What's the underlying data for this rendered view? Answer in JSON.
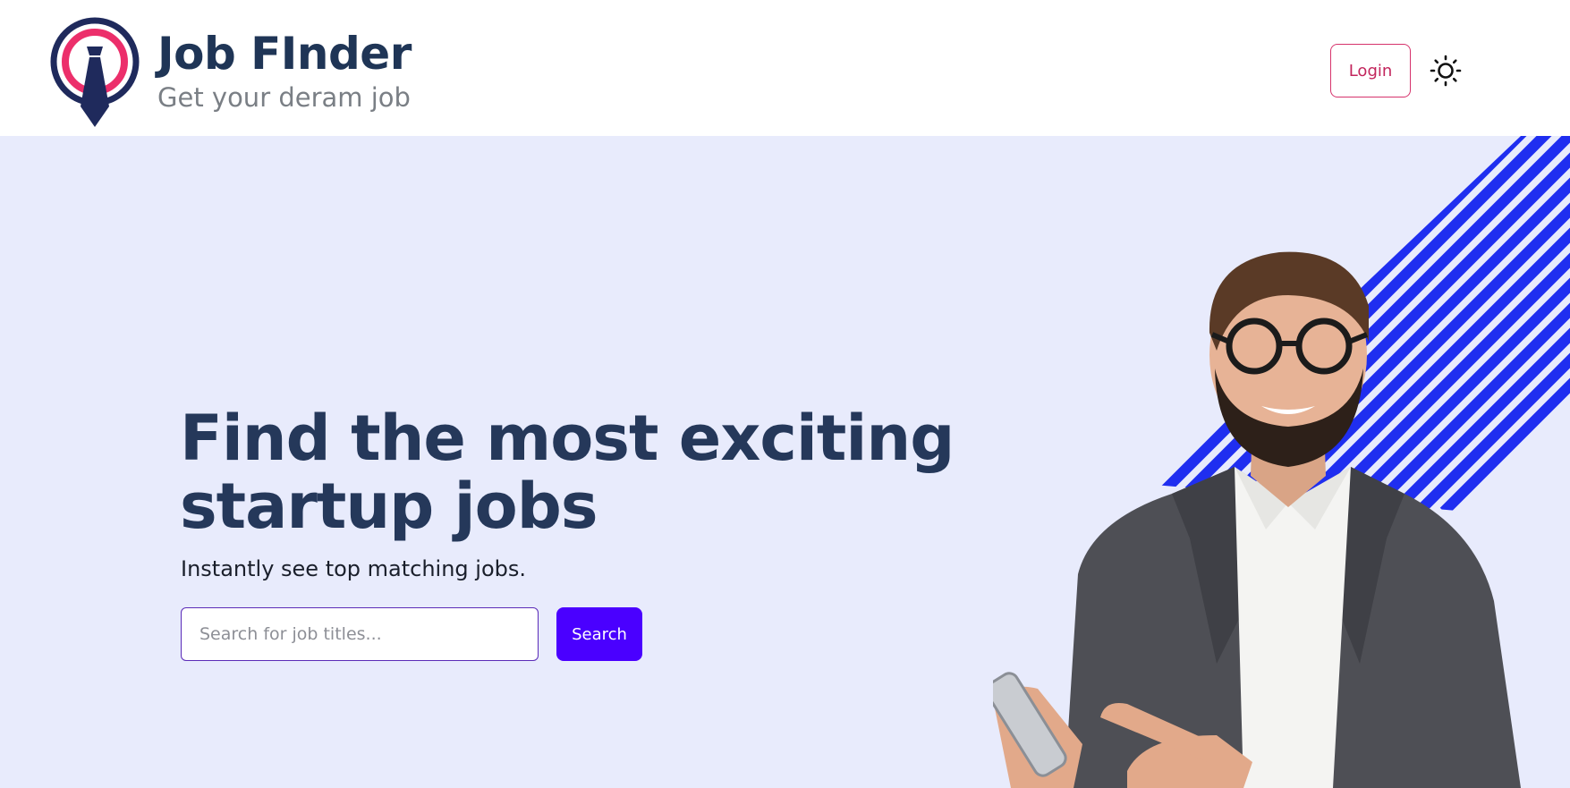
{
  "header": {
    "brand_title": "Job FInder",
    "brand_subtitle": "Get your deram job",
    "login_label": "Login",
    "theme_icon": "sun-icon"
  },
  "hero": {
    "headline": "Find the most exciting startup jobs",
    "subline": "Instantly see top matching jobs.",
    "search_placeholder": "Search for job titles...",
    "search_value": "",
    "search_button_label": "Search",
    "image": "smiling-man-with-glasses-holding-phone"
  },
  "colors": {
    "header_bg": "#ffffff",
    "hero_bg": "#e8ebfc",
    "headline": "#25385a",
    "primary_button": "#4a00ff",
    "login_accent": "#c2255c",
    "stripes": "#1f2ef0",
    "logo_pink": "#ec2f6b",
    "logo_navy": "#1f2a5c"
  }
}
